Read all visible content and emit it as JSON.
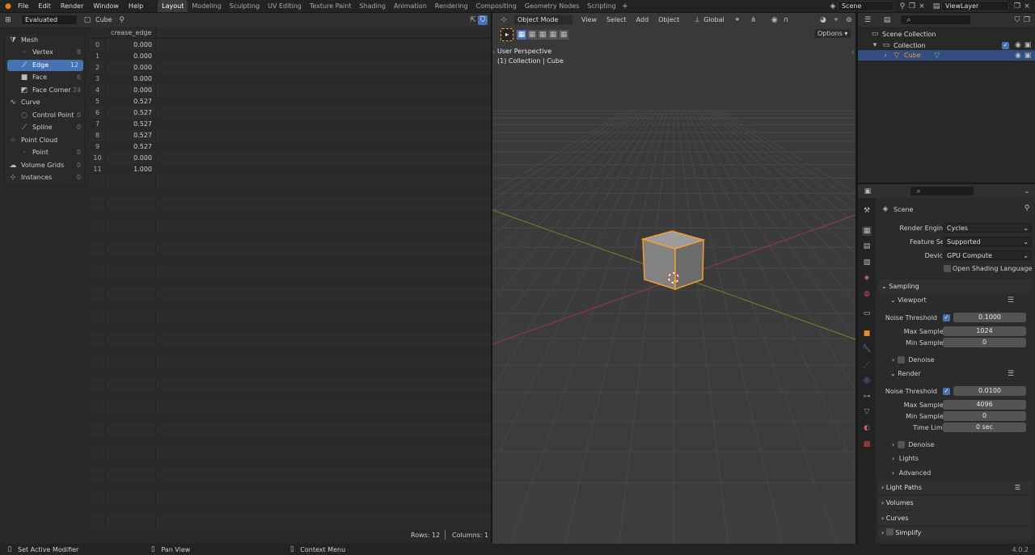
{
  "topbar": {
    "menus": [
      "File",
      "Edit",
      "Render",
      "Window",
      "Help"
    ],
    "workspaces": [
      "Layout",
      "Modeling",
      "Sculpting",
      "UV Editing",
      "Texture Paint",
      "Shading",
      "Animation",
      "Rendering",
      "Compositing",
      "Geometry Nodes",
      "Scripting"
    ],
    "active_workspace": "Layout",
    "scene": "Scene",
    "view_layer": "ViewLayer"
  },
  "sheet": {
    "mode": "Evaluated",
    "object": "Cube",
    "column_header": "crease_edge",
    "tree": [
      {
        "label": "Mesh",
        "count": ""
      },
      {
        "label": "Vertex",
        "count": "8"
      },
      {
        "label": "Edge",
        "count": "12"
      },
      {
        "label": "Face",
        "count": "6"
      },
      {
        "label": "Face Corner",
        "count": "24"
      },
      {
        "label": "Curve",
        "count": ""
      },
      {
        "label": "Control Point",
        "count": "0"
      },
      {
        "label": "Spline",
        "count": "0"
      },
      {
        "label": "Point Cloud",
        "count": ""
      },
      {
        "label": "Point",
        "count": "0"
      },
      {
        "label": "Volume Grids",
        "count": "0"
      },
      {
        "label": "Instances",
        "count": "0"
      }
    ],
    "rows": [
      {
        "i": "0",
        "v": "0.000"
      },
      {
        "i": "1",
        "v": "0.000"
      },
      {
        "i": "2",
        "v": "0.000"
      },
      {
        "i": "3",
        "v": "0.000"
      },
      {
        "i": "4",
        "v": "0.000"
      },
      {
        "i": "5",
        "v": "0.527"
      },
      {
        "i": "6",
        "v": "0.527"
      },
      {
        "i": "7",
        "v": "0.527"
      },
      {
        "i": "8",
        "v": "0.527"
      },
      {
        "i": "9",
        "v": "0.527"
      },
      {
        "i": "10",
        "v": "0.000"
      },
      {
        "i": "11",
        "v": "1.000"
      }
    ],
    "rows_label": "Rows: 12",
    "columns_label": "Columns: 1"
  },
  "viewport": {
    "mode": "Object Mode",
    "menus": [
      "View",
      "Select",
      "Add",
      "Object"
    ],
    "orientation": "Global",
    "options": "Options",
    "info1": "User Perspective",
    "info2": "(1) Collection | Cube"
  },
  "outliner": {
    "scene_collection": "Scene Collection",
    "collection": "Collection",
    "object": "Cube"
  },
  "properties": {
    "context": "Scene",
    "render_engine_label": "Render Engine",
    "render_engine": "Cycles",
    "feature_set_label": "Feature Set",
    "feature_set": "Supported",
    "device_label": "Device",
    "device": "GPU Compute",
    "osl_label": "Open Shading Language",
    "sampling": "Sampling",
    "viewport": "Viewport",
    "noise_threshold_label": "Noise Threshold",
    "vp_noise": "0.1000",
    "max_samples_label": "Max Samples",
    "vp_max": "1024",
    "min_samples_label": "Min Samples",
    "vp_min": "0",
    "denoise": "Denoise",
    "render": "Render",
    "r_noise": "0.0100",
    "r_max": "4096",
    "r_min": "0",
    "time_limit_label": "Time Limit",
    "time_limit": "0 sec",
    "lights": "Lights",
    "advanced": "Advanced",
    "light_paths": "Light Paths",
    "volumes": "Volumes",
    "curves": "Curves",
    "simplify": "Simplify"
  },
  "status": {
    "left": "Set Active Modifier",
    "mid": "Pan View",
    "right": "Context Menu",
    "version": "4.0.2"
  },
  "colors": {
    "accent": "#4772b3",
    "selection_orange": "#f0a030"
  }
}
